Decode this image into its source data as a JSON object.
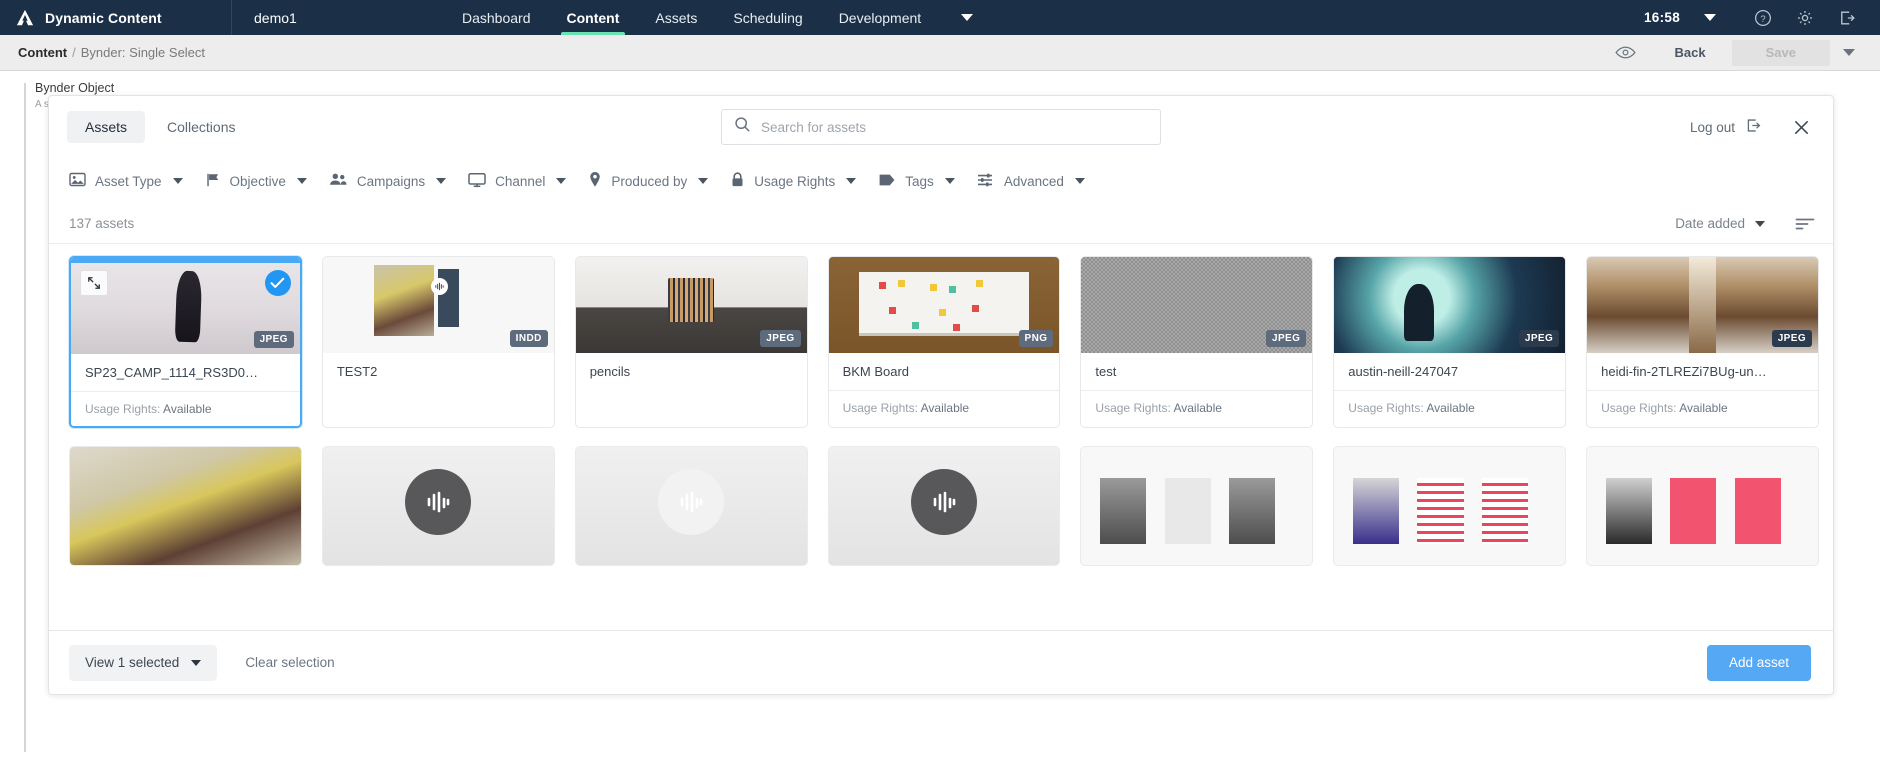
{
  "topnav": {
    "brand": "Dynamic Content",
    "account": "demo1",
    "links": [
      {
        "label": "Dashboard",
        "active": false
      },
      {
        "label": "Content",
        "active": true
      },
      {
        "label": "Assets",
        "active": false
      },
      {
        "label": "Scheduling",
        "active": false
      },
      {
        "label": "Development",
        "active": false
      }
    ],
    "time": "16:58",
    "icons": [
      "help-icon",
      "gear-icon",
      "logout-icon"
    ]
  },
  "breadcrumb": {
    "current": "Content",
    "separator": "/",
    "tail": "Bynder: Single Select",
    "preview_icon": "eye-icon",
    "back_label": "Back",
    "save_label": "Save"
  },
  "field": {
    "label": "Bynder Object",
    "sub": "A s"
  },
  "modal": {
    "tabs": [
      {
        "label": "Assets",
        "active": true
      },
      {
        "label": "Collections",
        "active": false
      }
    ],
    "search": {
      "placeholder": "Search for assets",
      "value": "",
      "icon": "search-icon"
    },
    "logout_label": "Log out",
    "logout_icon": "logout-icon",
    "close_icon": "close-icon",
    "filters": [
      {
        "label": "Asset Type",
        "icon": "image-icon"
      },
      {
        "label": "Objective",
        "icon": "flag-icon"
      },
      {
        "label": "Campaigns",
        "icon": "people-icon"
      },
      {
        "label": "Channel",
        "icon": "monitor-icon"
      },
      {
        "label": "Produced by",
        "icon": "pin-icon"
      },
      {
        "label": "Usage Rights",
        "icon": "lock-icon"
      },
      {
        "label": "Tags",
        "icon": "tag-icon"
      },
      {
        "label": "Advanced",
        "icon": "sliders-icon"
      }
    ],
    "count_text": "137 assets",
    "sort_label": "Date added",
    "sort_icon": "sort-icon",
    "assets": [
      {
        "name": "SP23_CAMP_1114_RS3D0…",
        "format": "JPEG",
        "usage_rights_label": "Usage Rights:",
        "usage_rights_value": "Available",
        "selected": true,
        "thumb_class": "img-dress",
        "badge_dark": false
      },
      {
        "name": "TEST2",
        "format": "INDD",
        "usage_rights_label": "",
        "usage_rights_value": "",
        "selected": false,
        "thumb_class": "img-indd",
        "badge_dark": false
      },
      {
        "name": "pencils",
        "format": "JPEG",
        "usage_rights_label": "",
        "usage_rights_value": "",
        "selected": false,
        "thumb_class": "img-pencils",
        "badge_dark": false
      },
      {
        "name": "BKM Board",
        "format": "PNG",
        "usage_rights_label": "Usage Rights:",
        "usage_rights_value": "Available",
        "selected": false,
        "thumb_class": "img-bkm",
        "badge_dark": false
      },
      {
        "name": "test",
        "format": "JPEG",
        "usage_rights_label": "Usage Rights:",
        "usage_rights_value": "Available",
        "selected": false,
        "thumb_class": "img-test",
        "badge_dark": false
      },
      {
        "name": "austin-neill-247047",
        "format": "JPEG",
        "usage_rights_label": "Usage Rights:",
        "usage_rights_value": "Available",
        "selected": false,
        "thumb_class": "img-austin",
        "badge_dark": true
      },
      {
        "name": "heidi-fin-2TLREZi7BUg-un…",
        "format": "JPEG",
        "usage_rights_label": "Usage Rights:",
        "usage_rights_value": "Available",
        "selected": false,
        "thumb_class": "img-heidi",
        "badge_dark": true
      }
    ],
    "assets_row2": [
      {
        "thumb_class": "img-food",
        "placeholder": false,
        "icon": ""
      },
      {
        "thumb_class": "p-grey",
        "placeholder": true,
        "icon": "waveform-icon",
        "icon_color": "#58585a"
      },
      {
        "thumb_class": "p-grey",
        "placeholder": true,
        "icon": "waveform-icon",
        "icon_color": "#f2f2f2"
      },
      {
        "thumb_class": "p-grey",
        "placeholder": true,
        "icon": "waveform-icon",
        "icon_color": "#58585a"
      },
      {
        "thumb_class": "p-rapa",
        "placeholder": false,
        "icon": ""
      },
      {
        "thumb_class": "p-rapb",
        "placeholder": false,
        "icon": ""
      },
      {
        "thumb_class": "p-rapc",
        "placeholder": false,
        "icon": ""
      }
    ],
    "footer": {
      "view_selected_label": "View 1 selected",
      "clear_label": "Clear selection",
      "add_label": "Add asset"
    }
  },
  "colors": {
    "topnav_bg": "#1b3047",
    "accent_green": "#6ae3b4",
    "accent_blue": "#49a9f5",
    "button_blue": "#55a9f4"
  }
}
